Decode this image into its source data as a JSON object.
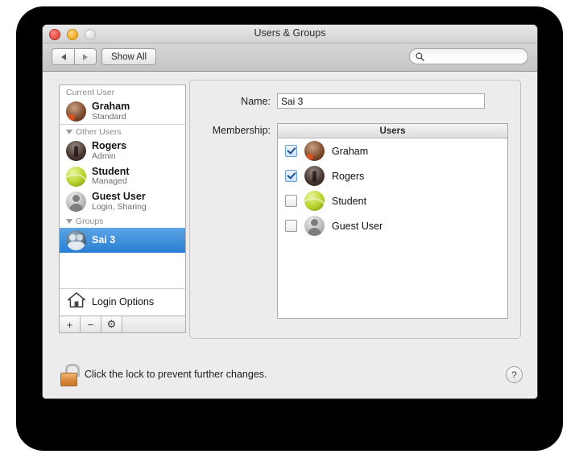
{
  "window": {
    "title": "Users & Groups",
    "traffic_lights": [
      "close-button",
      "minimize-button",
      "zoom-button"
    ]
  },
  "toolbar": {
    "back_label": "◀",
    "forward_label": "▶",
    "show_all_label": "Show All",
    "search": {
      "value": "",
      "placeholder": ""
    }
  },
  "sidebar": {
    "sections": [
      {
        "heading": "Current User",
        "has_disclosure": false,
        "items": [
          {
            "name": "Graham",
            "sub": "Standard",
            "avatar": "av-graham",
            "selected": false
          }
        ]
      },
      {
        "heading": "Other Users",
        "has_disclosure": true,
        "items": [
          {
            "name": "Rogers",
            "sub": "Admin",
            "avatar": "av-rogers",
            "selected": false
          },
          {
            "name": "Student",
            "sub": "Managed",
            "avatar": "av-student",
            "selected": false
          },
          {
            "name": "Guest User",
            "sub": "Login, Sharing",
            "avatar": "av-guest",
            "selected": false
          }
        ]
      },
      {
        "heading": "Groups",
        "has_disclosure": true,
        "items": [
          {
            "name": "Sai 3",
            "sub": "",
            "avatar": "av-group",
            "selected": true
          }
        ]
      }
    ],
    "login_options_label": "Login Options",
    "buttons": {
      "add": "+",
      "remove": "−",
      "settings": "⚙"
    }
  },
  "main": {
    "name_label": "Name:",
    "name_value": "Sai 3",
    "membership_label": "Membership:",
    "table_header": "Users",
    "rows": [
      {
        "label": "Graham",
        "checked": true,
        "avatar": "av-graham"
      },
      {
        "label": "Rogers",
        "checked": true,
        "avatar": "av-rogers"
      },
      {
        "label": "Student",
        "checked": false,
        "avatar": "av-student"
      },
      {
        "label": "Guest User",
        "checked": false,
        "avatar": "av-guest"
      }
    ]
  },
  "footer": {
    "lock_state": "unlocked",
    "lock_text": "Click the lock to prevent further changes.",
    "help_label": "?"
  },
  "colors": {
    "selection_blue": "#2a7fd4",
    "window_bg": "#ececec",
    "lock_orange": "#d98a3c"
  }
}
